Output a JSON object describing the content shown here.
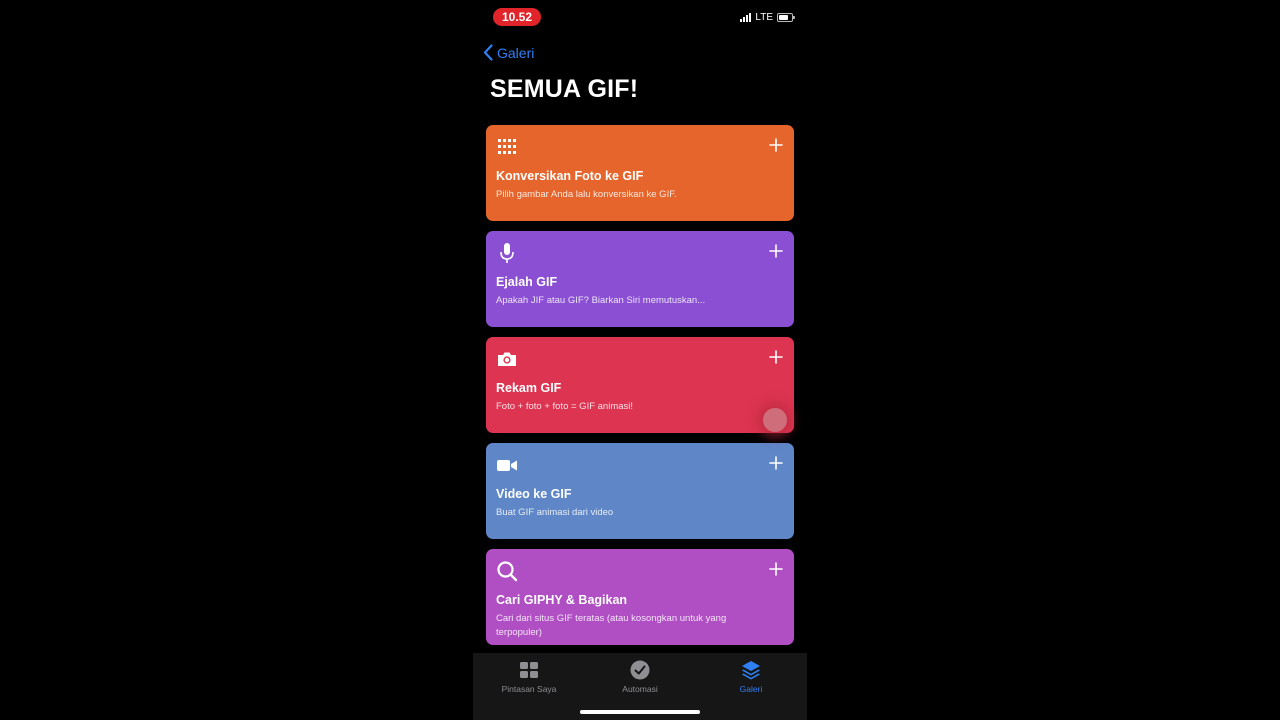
{
  "status": {
    "time": "10.52",
    "network": "LTE"
  },
  "nav": {
    "back_label": "Galeri"
  },
  "page": {
    "title": "SEMUA GIF!"
  },
  "cards": [
    {
      "title": "Konversikan Foto ke GIF",
      "description": "Pilih gambar Anda lalu konversikan ke GIF.",
      "icon": "grid-icon",
      "color": "#e5652c"
    },
    {
      "title": "Ejalah GIF",
      "description": "Apakah JIF atau GIF? Biarkan Siri memutuskan...",
      "icon": "microphone-icon",
      "color": "#8a4fd2"
    },
    {
      "title": "Rekam GIF",
      "description": "Foto + foto + foto = GIF animasi!",
      "icon": "camera-icon",
      "color": "#dc3451"
    },
    {
      "title": "Video ke GIF",
      "description": "Buat GIF animasi dari video",
      "icon": "video-camera-icon",
      "color": "#5f86c7"
    },
    {
      "title": "Cari GIPHY & Bagikan",
      "description": "Cari dari situs GIF teratas (atau kosongkan untuk yang terpopuler)",
      "icon": "search-icon",
      "color": "#b04fc4"
    }
  ],
  "tabbar": {
    "items": [
      {
        "label": "Pintasan Saya",
        "icon": "grid-squares-icon",
        "active": false
      },
      {
        "label": "Automasi",
        "icon": "clock-check-icon",
        "active": false
      },
      {
        "label": "Galeri",
        "icon": "layers-icon",
        "active": true
      }
    ]
  },
  "colors": {
    "accent": "#2f80f5",
    "status_time_bg": "#e0242a"
  }
}
